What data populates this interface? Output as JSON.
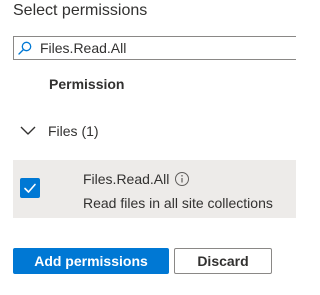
{
  "panel": {
    "title": "Select permissions"
  },
  "search": {
    "value": "Files.Read.All",
    "icon": "search-icon"
  },
  "table": {
    "column_header": "Permission"
  },
  "group": {
    "label": "Files (1)",
    "expanded": true,
    "icon": "chevron-down-icon"
  },
  "permissions": [
    {
      "name": "Files.Read.All",
      "description": "Read files in all site collections",
      "checked": true,
      "info_icon": "info-icon"
    }
  ],
  "buttons": {
    "add_label": "Add permissions",
    "discard_label": "Discard"
  },
  "colors": {
    "accent": "#0078d4",
    "selected_row_bg": "#edebe9",
    "text": "#323130",
    "border": "#8a8886"
  }
}
